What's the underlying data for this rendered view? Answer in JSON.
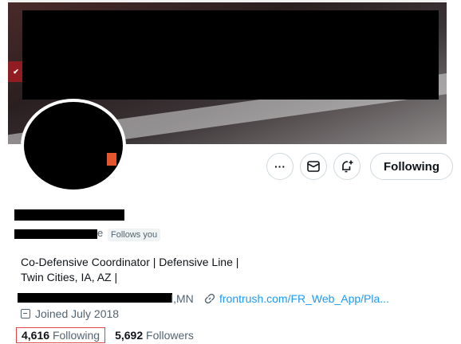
{
  "actions": {
    "more_glyph": "···",
    "following_label": "Following"
  },
  "profile": {
    "handle_tail": "e",
    "follows_you": "Follows you",
    "bio_line1": "Co-Defensive Coordinator | Defensive Line |",
    "bio_line2": "Twin Cities, IA, AZ |",
    "location_tail": "l,MN",
    "website": "frontrush.com/FR_Web_App/Pla...",
    "joined": "Joined July 2018"
  },
  "stats": {
    "following_count": "4,616",
    "following_label": "Following",
    "followers_count": "5,692",
    "followers_label": "Followers"
  },
  "icons": {
    "more": "more-icon",
    "message": "mail-icon",
    "notify": "bell-plus-icon",
    "link": "link-icon",
    "calendar": "calendar-icon"
  },
  "colors": {
    "link": "#1d9bf0",
    "muted": "#536471",
    "highlight": "#e0434b"
  }
}
